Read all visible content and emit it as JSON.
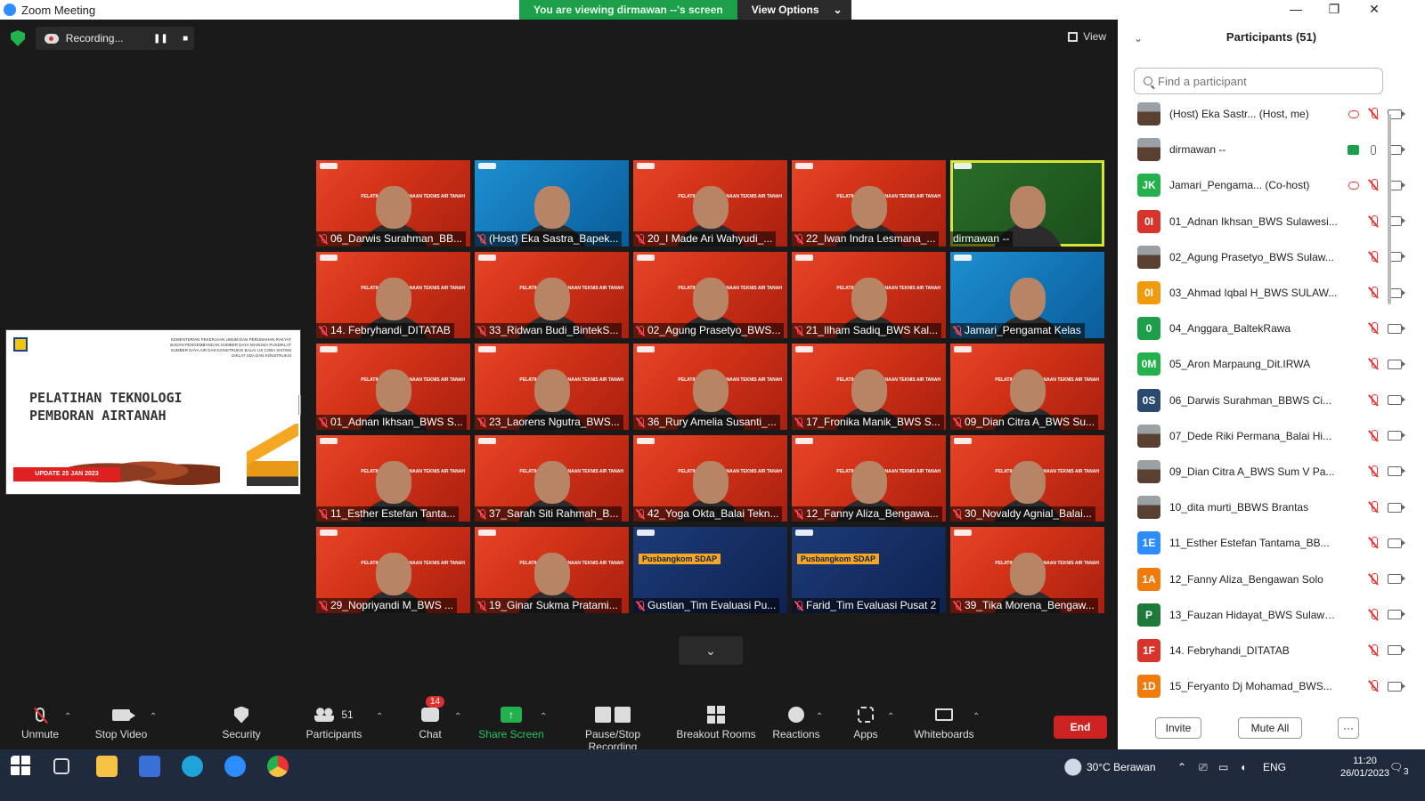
{
  "window": {
    "title": "Zoom Meeting",
    "minimize": "—",
    "maximize": "❐",
    "close": "✕"
  },
  "banner": {
    "text": "You are viewing dirmawan --'s screen",
    "view_options": "View Options",
    "caret": "⌄"
  },
  "recording": {
    "label": "Recording...",
    "pause": "❚❚",
    "stop": "■"
  },
  "view_button": "View",
  "slide": {
    "header": "KEMENTERIAN PEKERJAAN UMUM DAN PERUMAHAN RAKYAT BADAN PENGEMBANGAN SUMBER DAYA MANUSIA PUSDIKLAT SUMBER DAYA AIR DAN KONSTRUKSI BALAI UJI COBA SISTEM DIKLAT SDA DAN KONSTRUKSI",
    "title_line1": "PELATIHAN TEKNOLOGI",
    "title_line2": "PEMBORAN AIRTANAH",
    "date": "UPDATE 25 JAN 2023"
  },
  "tile_brand": "PELATIHAN PERENCANAAN TEKNIS AIR TANAH",
  "tiles": [
    {
      "name": "06_Darwis Surahman_BB...",
      "muted": true,
      "bg": "red"
    },
    {
      "name": "(Host) Eka Sastra_Bapek...",
      "muted": true,
      "bg": "blue"
    },
    {
      "name": "20_I Made Ari Wahyudi_...",
      "muted": true,
      "bg": "red"
    },
    {
      "name": "22_Iwan Indra Lesmana_...",
      "muted": true,
      "bg": "red"
    },
    {
      "name": "dirmawan --",
      "muted": false,
      "bg": "green",
      "speaking": true
    },
    {
      "name": "14. Febryhandi_DITATAB",
      "muted": true,
      "bg": "red"
    },
    {
      "name": "33_Ridwan Budi_BintekS...",
      "muted": true,
      "bg": "red"
    },
    {
      "name": "02_Agung Prasetyo_BWS...",
      "muted": true,
      "bg": "red"
    },
    {
      "name": "21_Ilham Sadiq_BWS Kal...",
      "muted": true,
      "bg": "red"
    },
    {
      "name": "Jamari_Pengamat Kelas",
      "muted": true,
      "bg": "blue"
    },
    {
      "name": "01_Adnan Ikhsan_BWS S...",
      "muted": true,
      "bg": "red"
    },
    {
      "name": "23_Laorens Ngutra_BWS...",
      "muted": true,
      "bg": "red"
    },
    {
      "name": "36_Rury Amelia Susanti_...",
      "muted": true,
      "bg": "red"
    },
    {
      "name": "17_Fronika Manik_BWS S...",
      "muted": true,
      "bg": "red"
    },
    {
      "name": "09_Dian Citra A_BWS Su...",
      "muted": true,
      "bg": "red"
    },
    {
      "name": "11_Esther Estefan Tanta...",
      "muted": true,
      "bg": "red"
    },
    {
      "name": "37_Sarah Siti Rahmah_B...",
      "muted": true,
      "bg": "red"
    },
    {
      "name": "42_Yoga Okta_Balai Tekn...",
      "muted": true,
      "bg": "red"
    },
    {
      "name": "12_Fanny Aliza_Bengawa...",
      "muted": true,
      "bg": "red"
    },
    {
      "name": "30_Novaldy Agnial_Balai...",
      "muted": true,
      "bg": "red"
    },
    {
      "name": "29_Nopriyandi M_BWS ...",
      "muted": true,
      "bg": "red"
    },
    {
      "name": "19_Ginar Sukma Pratami...",
      "muted": true,
      "bg": "red"
    },
    {
      "name": "Gustian_Tim Evaluasi Pu...",
      "muted": true,
      "bg": "dark",
      "overlay": "Pusbangkom SDAP"
    },
    {
      "name": "Farid_Tim Evaluasi Pusat 2",
      "muted": true,
      "bg": "dark",
      "overlay": "Pusbangkom SDAP"
    },
    {
      "name": "39_Tika Morena_Bengaw...",
      "muted": true,
      "bg": "red"
    }
  ],
  "page_down": "⌄",
  "toolbar": {
    "unmute": "Unmute",
    "stop_video": "Stop Video",
    "security": "Security",
    "participants": "Participants",
    "participants_count": "51",
    "chat": "Chat",
    "chat_badge": "14",
    "share_screen": "Share Screen",
    "share_arrow": "↑",
    "pause_stop_recording": "Pause/Stop Recording",
    "breakout_rooms": "Breakout Rooms",
    "reactions": "Reactions",
    "apps": "Apps",
    "whiteboards": "Whiteboards",
    "end": "End",
    "caret": "⌃"
  },
  "panel": {
    "title": "Participants (51)",
    "collapse": "⌄",
    "search_placeholder": "Find a participant",
    "invite": "Invite",
    "mute_all": "Mute All",
    "more": "···",
    "participants": [
      {
        "name": "(Host) Eka Sastr... (Host, me)",
        "avatar": "",
        "color": "#9aa0a6",
        "photo": true,
        "rec": true,
        "mic": "off"
      },
      {
        "name": "dirmawan --",
        "avatar": "",
        "color": "#9aa0a6",
        "photo": true,
        "share": true,
        "mic": "on"
      },
      {
        "name": "Jamari_Pengama... (Co-host)",
        "avatar": "JK",
        "color": "#22b14c",
        "rec": true,
        "mic": "off"
      },
      {
        "name": "01_Adnan Ikhsan_BWS Sulawesi...",
        "avatar": "0I",
        "color": "#d9342b",
        "mic": "off"
      },
      {
        "name": "02_Agung Prasetyo_BWS Sulaw...",
        "avatar": "",
        "color": "#9aa0a6",
        "photo": true,
        "mic": "off"
      },
      {
        "name": "03_Ahmad Iqbal H_BWS SULAW...",
        "avatar": "0I",
        "color": "#f09a0c",
        "mic": "off"
      },
      {
        "name": "04_Anggara_BaltekRawa",
        "avatar": "0",
        "color": "#1d9e4b",
        "mic": "off"
      },
      {
        "name": "05_Aron Marpaung_Dit.IRWA",
        "avatar": "0M",
        "color": "#22b14c",
        "mic": "off"
      },
      {
        "name": "06_Darwis Surahman_BBWS Ci...",
        "avatar": "0S",
        "color": "#2b4a6f",
        "mic": "off"
      },
      {
        "name": "07_Dede Riki Permana_Balai Hi...",
        "avatar": "",
        "color": "#333",
        "photo": true,
        "mic": "off"
      },
      {
        "name": "09_Dian Citra A_BWS Sum V Pa...",
        "avatar": "",
        "color": "#5b7db3",
        "photo": true,
        "mic": "off"
      },
      {
        "name": "10_dita murti_BBWS Brantas",
        "avatar": "",
        "color": "#222",
        "photo": true,
        "mic": "off"
      },
      {
        "name": "11_Esther Estefan Tantama_BB...",
        "avatar": "1E",
        "color": "#2d8cff",
        "mic": "off"
      },
      {
        "name": "12_Fanny Aliza_Bengawan Solo",
        "avatar": "1A",
        "color": "#f07a0c",
        "mic": "off"
      },
      {
        "name": "13_Fauzan Hidayat_BWS Sulawe...",
        "avatar": "P",
        "color": "#1d7a3a",
        "mic": "off"
      },
      {
        "name": "14. Febryhandi_DITATAB",
        "avatar": "1F",
        "color": "#d9342b",
        "mic": "off"
      },
      {
        "name": "15_Feryanto Dj Mohamad_BWS...",
        "avatar": "1D",
        "color": "#f07a0c",
        "mic": "off"
      }
    ]
  },
  "taskbar": {
    "weather": "30°C Berawan",
    "lang": "ENG",
    "time": "11:20",
    "date": "26/01/2023",
    "notif": "3"
  }
}
